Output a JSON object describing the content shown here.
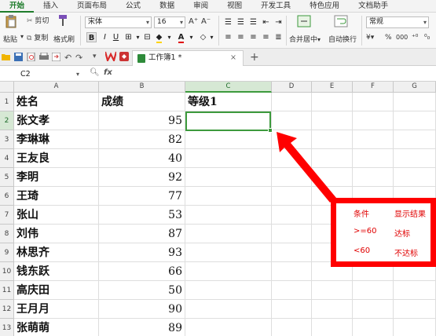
{
  "menu": {
    "tabs": [
      {
        "label": "开始",
        "active": true
      },
      {
        "label": "插入"
      },
      {
        "label": "页面布局"
      },
      {
        "label": "公式"
      },
      {
        "label": "数据"
      },
      {
        "label": "审阅"
      },
      {
        "label": "视图"
      },
      {
        "label": "开发工具"
      },
      {
        "label": "特色应用"
      },
      {
        "label": "文档助手"
      }
    ]
  },
  "ribbon": {
    "cut_label": "剪切",
    "paste_label": "粘贴",
    "copy_label": "复制",
    "format_painter_label": "格式刷",
    "font_name": "宋体",
    "font_size": "16",
    "merge_center_label": "合并居中",
    "wrap_label": "自动换行",
    "number_format": "常规",
    "percent_label": "%",
    "comma_label": "000"
  },
  "quickbar": {
    "doc_tab_label": "工作簿1 *",
    "new_tab_symbol": "+",
    "close_symbol": "×"
  },
  "formula_bar": {
    "name_box": "C2",
    "fx_label": "fx",
    "formula": ""
  },
  "grid": {
    "column_headers": [
      "A",
      "B",
      "C",
      "D",
      "E",
      "F",
      "G"
    ],
    "row_headers": [
      "1",
      "2",
      "3",
      "4",
      "5",
      "6",
      "7",
      "8",
      "9",
      "10",
      "11",
      "12",
      "13"
    ],
    "selected_cell": "C2",
    "header_row": {
      "a": "姓名",
      "b": "成绩",
      "c": "等级1"
    },
    "rows": [
      {
        "name": "张文孝",
        "score": "95"
      },
      {
        "name": "李琳琳",
        "score": "82"
      },
      {
        "name": "王友良",
        "score": "40"
      },
      {
        "name": "李明",
        "score": "92"
      },
      {
        "name": "王琦",
        "score": "77"
      },
      {
        "name": "张山",
        "score": "53"
      },
      {
        "name": "刘伟",
        "score": "87"
      },
      {
        "name": "林思齐",
        "score": "93"
      },
      {
        "name": "钱东跃",
        "score": "66"
      },
      {
        "name": "高庆田",
        "score": "50"
      },
      {
        "name": "王月月",
        "score": "90"
      },
      {
        "name": "张萌萌",
        "score": "89"
      }
    ]
  },
  "annotation": {
    "color": "#ff0000",
    "header_condition": "条件",
    "header_result": "显示结果",
    "rule1_condition": ">=60",
    "rule1_result": "达标",
    "rule2_condition": "<60",
    "rule2_result": "不达标"
  },
  "colors": {
    "accent_green": "#3d9a3d",
    "annotation_red": "#ff0000"
  }
}
